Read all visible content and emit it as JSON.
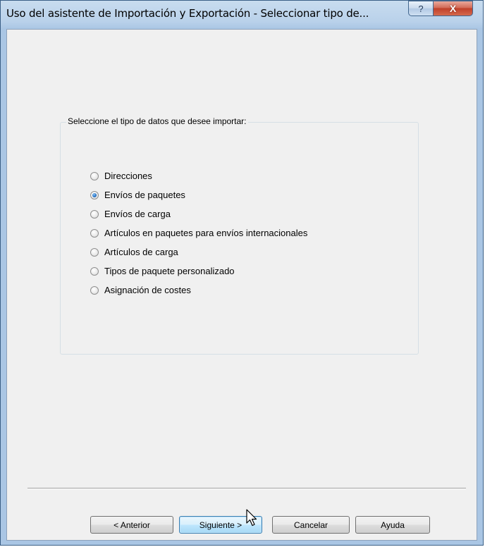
{
  "window": {
    "title": "Uso del asistente de Importación y Exportación - Seleccionar tipo de...",
    "help_label": "?",
    "close_label": "X"
  },
  "group": {
    "legend": "Seleccione el tipo de datos que desee importar:",
    "options": [
      {
        "label": "Direcciones",
        "selected": false
      },
      {
        "label": "Envíos de paquetes",
        "selected": true
      },
      {
        "label": "Envíos de carga",
        "selected": false
      },
      {
        "label": "Artículos en paquetes para envíos internacionales",
        "selected": false
      },
      {
        "label": "Artículos de carga",
        "selected": false
      },
      {
        "label": "Tipos de paquete personalizado",
        "selected": false
      },
      {
        "label": "Asignación de costes",
        "selected": false
      }
    ]
  },
  "buttons": {
    "previous": "< Anterior",
    "next": "Siguiente >",
    "cancel": "Cancelar",
    "help": "Ayuda"
  }
}
